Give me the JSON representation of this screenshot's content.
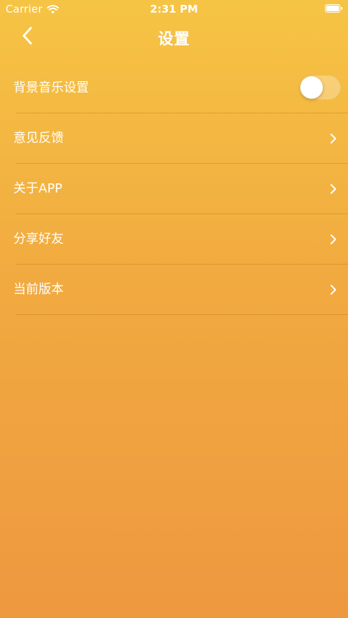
{
  "status_bar": {
    "carrier": "Carrier",
    "time": "2:31 PM",
    "wifi_icon": "wifi-icon",
    "battery_icon": "battery-icon"
  },
  "nav": {
    "title": "设置",
    "back_icon": "chevron-left-icon"
  },
  "settings": {
    "items": [
      {
        "label": "背景音乐设置",
        "control": "toggle",
        "toggle_on": false
      },
      {
        "label": "意见反馈",
        "control": "chevron"
      },
      {
        "label": "关于APP",
        "control": "chevron"
      },
      {
        "label": "分享好友",
        "control": "chevron"
      },
      {
        "label": "当前版本",
        "control": "chevron"
      }
    ]
  },
  "colors": {
    "gradient_top": "#F6C444",
    "gradient_bottom": "#EE9840",
    "text": "#FFFFFF"
  }
}
